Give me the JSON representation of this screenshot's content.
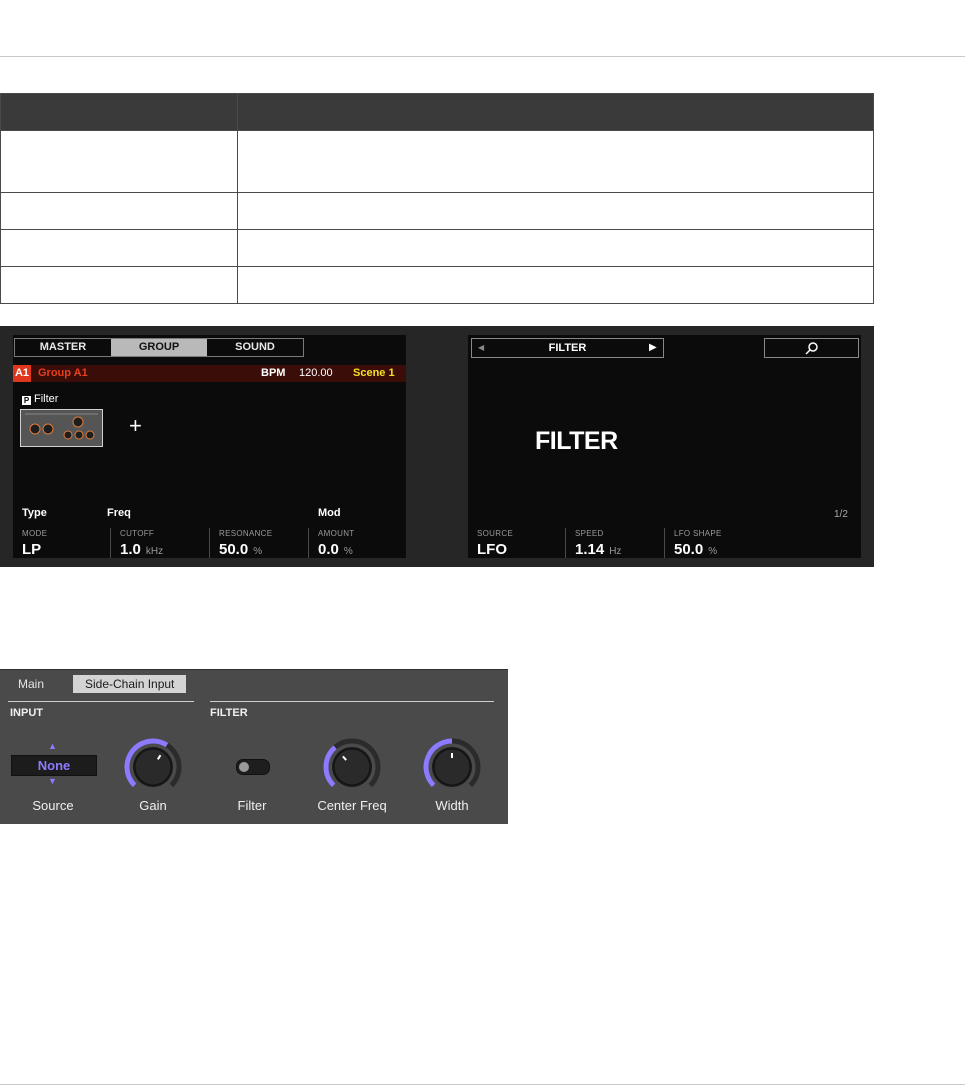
{
  "table": {
    "header": [
      "",
      ""
    ],
    "rows": [
      [
        "",
        ""
      ],
      [
        "",
        ""
      ],
      [
        "",
        ""
      ],
      [
        "",
        ""
      ]
    ]
  },
  "hardware": {
    "left": {
      "tabs": [
        {
          "label": "MASTER"
        },
        {
          "label": "GROUP",
          "active": true
        },
        {
          "label": "SOUND"
        }
      ],
      "group_badge": "A1",
      "group_name": "Group A1",
      "bpm_label": "BPM",
      "bpm_value": "120.00",
      "scene": "Scene 1",
      "plugin_label": "Filter",
      "add_symbol": "+",
      "sections": [
        "Type",
        "Freq",
        "Mod"
      ],
      "params": [
        {
          "name": "MODE",
          "value": "LP",
          "unit": ""
        },
        {
          "name": "CUTOFF",
          "value": "1.0",
          "unit": "kHz"
        },
        {
          "name": "RESONANCE",
          "value": "50.0",
          "unit": "%"
        },
        {
          "name": "AMOUNT",
          "value": "0.0",
          "unit": "%"
        }
      ]
    },
    "right": {
      "selector": "FILTER",
      "title": "FILTER",
      "page": "1/2",
      "params": [
        {
          "name": "SOURCE",
          "value": "LFO",
          "unit": ""
        },
        {
          "name": "SPEED",
          "value": "1.14",
          "unit": "Hz"
        },
        {
          "name": "LFO SHAPE",
          "value": "50.0",
          "unit": "%"
        }
      ]
    }
  },
  "plugin": {
    "tabs": [
      "Main",
      "Side-Chain Input"
    ],
    "groups": {
      "input": "INPUT",
      "filter": "FILTER"
    },
    "source": {
      "value": "None",
      "label": "Source"
    },
    "controls": [
      {
        "label": "Gain",
        "level": 0.62
      },
      {
        "label": "Filter"
      },
      {
        "label": "Center Freq",
        "level": 0.35
      },
      {
        "label": "Width",
        "level": 0.5
      }
    ]
  },
  "colors": {
    "accent": "#8c7bff",
    "group": "#e0361d",
    "scene": "#f3e024"
  }
}
